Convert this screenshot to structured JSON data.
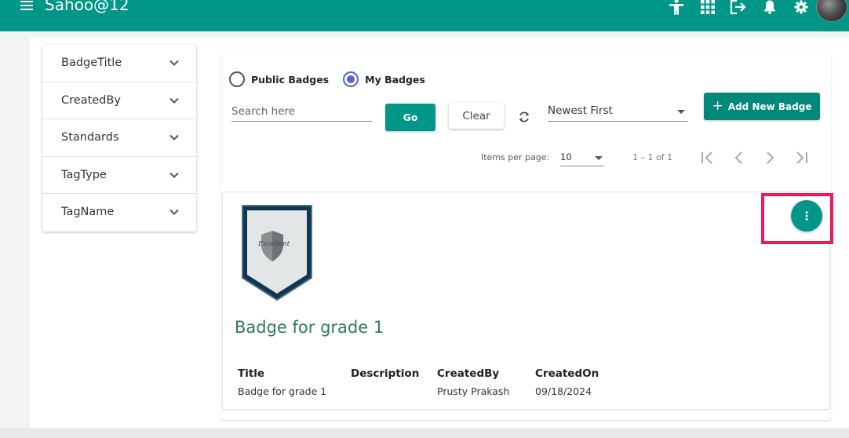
{
  "header": {
    "title": "Sahoo@12",
    "accent_color": "#009688",
    "icons": [
      "menu-icon",
      "accessibility-icon",
      "apps-grid-icon",
      "logout-icon",
      "notifications-icon",
      "settings-icon",
      "avatar"
    ]
  },
  "filters": {
    "items": [
      {
        "label": "BadgeTitle"
      },
      {
        "label": "CreatedBy"
      },
      {
        "label": "Standards"
      },
      {
        "label": "TagType"
      },
      {
        "label": "TagName"
      }
    ]
  },
  "toolbar": {
    "radio_public": "Public Badges",
    "radio_mine": "My Badges",
    "selected_radio": "My Badges",
    "search_placeholder": "Search here",
    "search_value": "",
    "go_label": "Go",
    "clear_label": "Clear",
    "sort_value": "Newest First",
    "add_label": "Add New Badge"
  },
  "paginator": {
    "items_per_page_label": "Items per page:",
    "items_per_page_value": "10",
    "range_label": "1 – 1 of 1"
  },
  "badge": {
    "emblem_text": "Excellent",
    "title": "Badge for grade 1",
    "fields": {
      "title_label": "Title",
      "title_value": "Badge for grade 1",
      "description_label": "Description",
      "description_value": "",
      "created_by_label": "CreatedBy",
      "created_by_value": "Prusty Prakash",
      "created_on_label": "CreatedOn",
      "created_on_value": "09/18/2024"
    },
    "title_color": "#2e7d4f",
    "highlight_color": "#f0185b"
  }
}
